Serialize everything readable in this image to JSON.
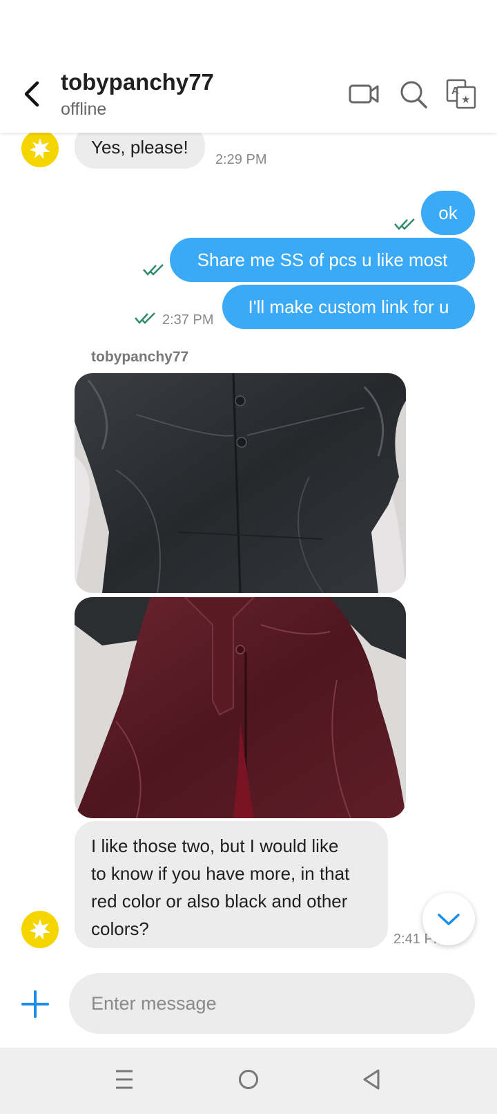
{
  "header": {
    "title": "tobypanchy77",
    "status": "offline",
    "icons": [
      "back-arrow-icon",
      "video-call-icon",
      "search-icon",
      "translate-icon"
    ]
  },
  "messages": [
    {
      "direction": "in",
      "text": "Yes, please!",
      "time": "2:29 PM"
    },
    {
      "direction": "out",
      "text": "ok",
      "read": true
    },
    {
      "direction": "out",
      "text": "Share me SS of pcs u like most",
      "read": true
    },
    {
      "direction": "out",
      "text": "I'll make custom link for u",
      "time": "2:37 PM",
      "read": true
    },
    {
      "direction": "in",
      "sender": "tobypanchy77",
      "type": "image",
      "description_icon": "black-leather-jacket-photo"
    },
    {
      "direction": "in",
      "type": "image",
      "description_icon": "burgundy-leather-coat-photo"
    },
    {
      "direction": "in",
      "lines": [
        "I like those two, but I would like",
        "to know if you have more, in that",
        "red color or also black and other",
        "colors?"
      ],
      "time": "2:41 PM"
    }
  ],
  "input": {
    "placeholder": "Enter message"
  },
  "colors": {
    "out_bubble": "#3baaf6",
    "in_bubble": "#ececec",
    "avatar": "#f5d500",
    "tick": "#2e8b6e",
    "accent": "#1a8ee8"
  }
}
